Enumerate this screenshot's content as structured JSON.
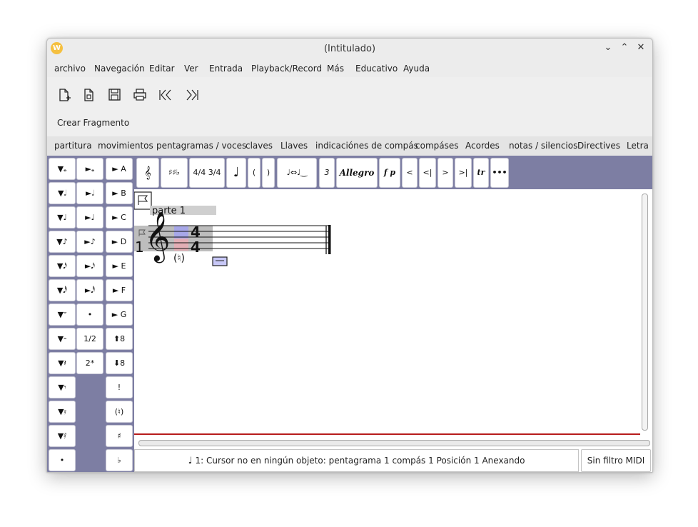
{
  "window": {
    "title": "(Intitulado)"
  },
  "menubar": [
    "archivo",
    "Navegación",
    "Editar",
    "Ver",
    "Entrada",
    "Playback/Record",
    "Más",
    "Educativo",
    "Ayuda"
  ],
  "toolbar": {
    "icons": [
      "new-document-icon",
      "open-template-icon",
      "save-icon",
      "print-icon",
      "skip-to-start-icon",
      "skip-to-end-icon"
    ],
    "fragment_label": "Crear Fragmento"
  },
  "tabs": [
    "partitura",
    "movimientos",
    "pentagramas / voces",
    "claves",
    "Llaves",
    "indicaciónes de compás",
    "compáses",
    "Acordes",
    "notas / silencios",
    "Directives",
    "Letra"
  ],
  "palette": {
    "col1": [
      "▼𝅝",
      "▼𝅗𝅥",
      "▼♩",
      "▼♪",
      "▼𝅘𝅥𝅯",
      "▼𝅘𝅥𝅰",
      "▼𝄻",
      "▼𝄼",
      "▼𝄽",
      "▼𝄾",
      "▼𝄿",
      "▼𝅀",
      "•"
    ],
    "col2": [
      "►𝅝",
      "►𝅗𝅥",
      "►♩",
      "►♪",
      "►𝅘𝅥𝅯",
      "►𝅘𝅥𝅰",
      "•",
      "1/2",
      "2*"
    ],
    "col3": [
      "► A",
      "► B",
      "► C",
      "► D",
      "► E",
      "► F",
      "► G",
      "⬆8",
      "⬇8",
      "!",
      "(♮)",
      "♯",
      "♭"
    ]
  },
  "editbar": [
    "𝄞",
    "♯♯♭",
    "4/4 3/4",
    "♩",
    "(",
    ")",
    "♩⇔♩‿",
    "3",
    "Allegro",
    "f p",
    "<",
    "<|",
    ">",
    ">|",
    "tr",
    "•••"
  ],
  "score": {
    "part_label": "parte 1",
    "staff_number": "1",
    "time_sig_top": "4",
    "time_sig_bottom": "4",
    "natural_mark": "(♮)"
  },
  "status": {
    "text": "1: Cursor no en ningún objeto: pentagrama 1 compás 1 Posición 1 Anexando",
    "midi_button": "Sin filtro MIDI"
  }
}
